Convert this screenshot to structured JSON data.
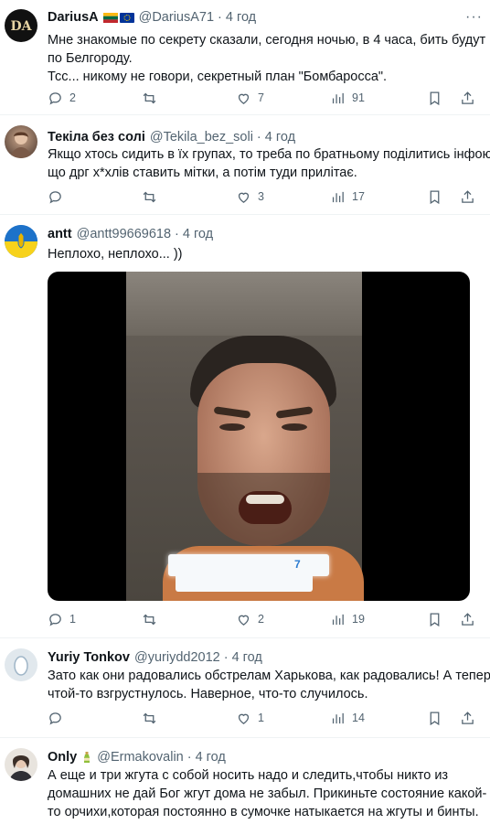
{
  "colors": {
    "text": "#0f1419",
    "secondary": "#536471",
    "divider": "#eff3f4"
  },
  "tweets": [
    {
      "name": "DariusA",
      "flags": [
        "lithuania-flag",
        "eu-flag"
      ],
      "handle": "@DariusA71",
      "dot": "·",
      "time": "4 год",
      "avatar_text": "DA",
      "text": [
        "Мне знакомые по секрету сказали, сегодня ночью, в 4 часа, бить будут",
        "по Белгороду.",
        "Тсс... никому не говори, секретный план \"Бомбаросса\"."
      ],
      "replies": "2",
      "retweets": "",
      "likes": "7",
      "views": "91"
    },
    {
      "name": "Текіла без солі",
      "handle": "@Tekila_bez_soli",
      "dot": "·",
      "time": "4 год",
      "text": [
        "Якщо хтось сидить в їх групах, то треба по братньому поділитись інфою,",
        "що дрг х*хлів ставить мітки, а потім туди прилітає."
      ],
      "replies": "",
      "retweets": "",
      "likes": "3",
      "views": "17"
    },
    {
      "name": "antt",
      "handle": "@antt99669618",
      "dot": "·",
      "time": "4 год",
      "text": [
        "Неплохо, неплохо... ))"
      ],
      "video_caption": "7",
      "replies": "1",
      "retweets": "",
      "likes": "2",
      "views": "19"
    },
    {
      "name": "Yuriy Tonkov",
      "handle": "@yuriydd2012",
      "dot": "·",
      "time": "4 год",
      "text": [
        "Зато как они радовались обстрелам Харькова, как радовались! А теперь",
        "чтой-то взгрустнулось. Наверное, что-то случилось."
      ],
      "replies": "",
      "retweets": "",
      "likes": "1",
      "views": "14"
    },
    {
      "name": "Only",
      "name_emoji": "bottle-emoji",
      "handle": "@Ermakovalin",
      "dot": "·",
      "time": "4 год",
      "text": [
        "А еще и три жгута с собой носить надо и следить,чтобы никто из",
        "домашних не дай Бог жгут дома не забыл. Прикиньте состояние какой-",
        "то орчихи,которая постоянно в сумочке натыкается на жгуты и бинты."
      ]
    }
  ],
  "more_label": "···"
}
